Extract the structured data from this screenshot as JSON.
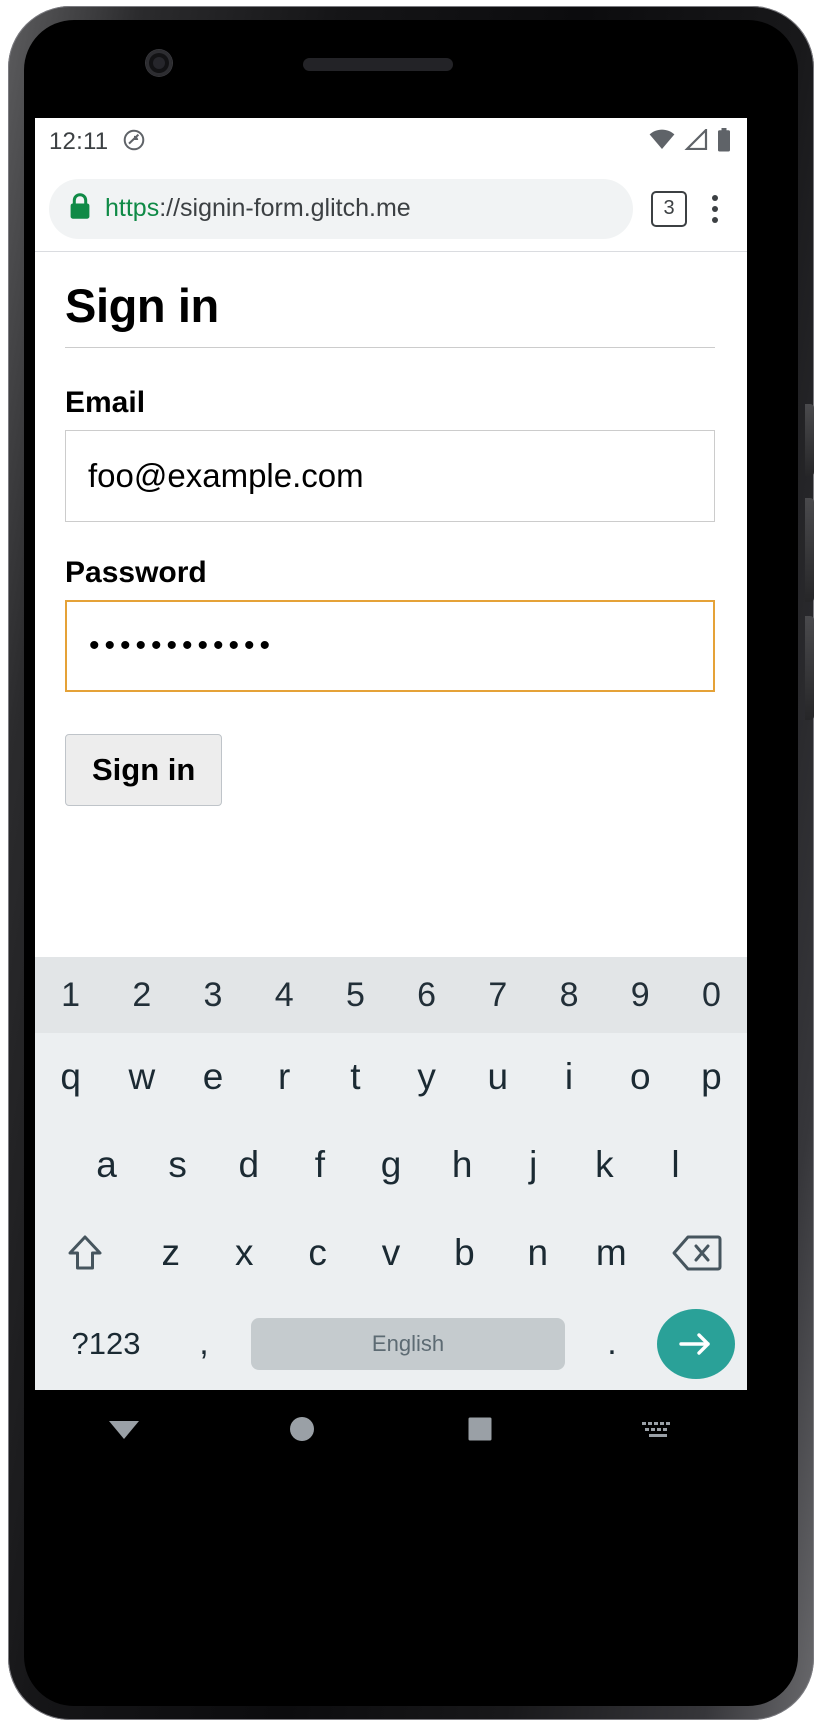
{
  "status_bar": {
    "time": "12:11",
    "icons": [
      "rotation-locked-icon",
      "wifi-icon",
      "cell-signal-icon",
      "battery-icon"
    ]
  },
  "browser": {
    "url_scheme": "https",
    "url_separator": "://",
    "url_host": "signin-form.glitch.me",
    "lock_icon": "lock-icon",
    "tab_count": "3",
    "menu_icon": "overflow-menu-icon"
  },
  "page": {
    "title": "Sign in",
    "email": {
      "label": "Email",
      "value": "foo@example.com",
      "placeholder": ""
    },
    "password": {
      "label": "Password",
      "value": "••••••••••••",
      "placeholder": "",
      "focused": true,
      "focus_border_color": "#e5a238"
    },
    "submit_label": "Sign in"
  },
  "keyboard": {
    "number_row": [
      "1",
      "2",
      "3",
      "4",
      "5",
      "6",
      "7",
      "8",
      "9",
      "0"
    ],
    "row_top": [
      "q",
      "w",
      "e",
      "r",
      "t",
      "y",
      "u",
      "i",
      "o",
      "p"
    ],
    "row_home": [
      "a",
      "s",
      "d",
      "f",
      "g",
      "h",
      "j",
      "k",
      "l"
    ],
    "row_bottom": [
      "z",
      "x",
      "c",
      "v",
      "b",
      "n",
      "m"
    ],
    "shift_icon": "shift-icon",
    "backspace_icon": "backspace-icon",
    "symbols_label": "?123",
    "comma_label": ",",
    "space_label": "English",
    "period_label": ".",
    "enter_icon": "enter-arrow-icon",
    "enter_color": "#2aa198"
  },
  "nav_bar": {
    "back_icon": "back-triangle-icon",
    "home_icon": "home-circle-icon",
    "recents_icon": "recents-square-icon",
    "keyboard_icon": "keyboard-icon"
  }
}
